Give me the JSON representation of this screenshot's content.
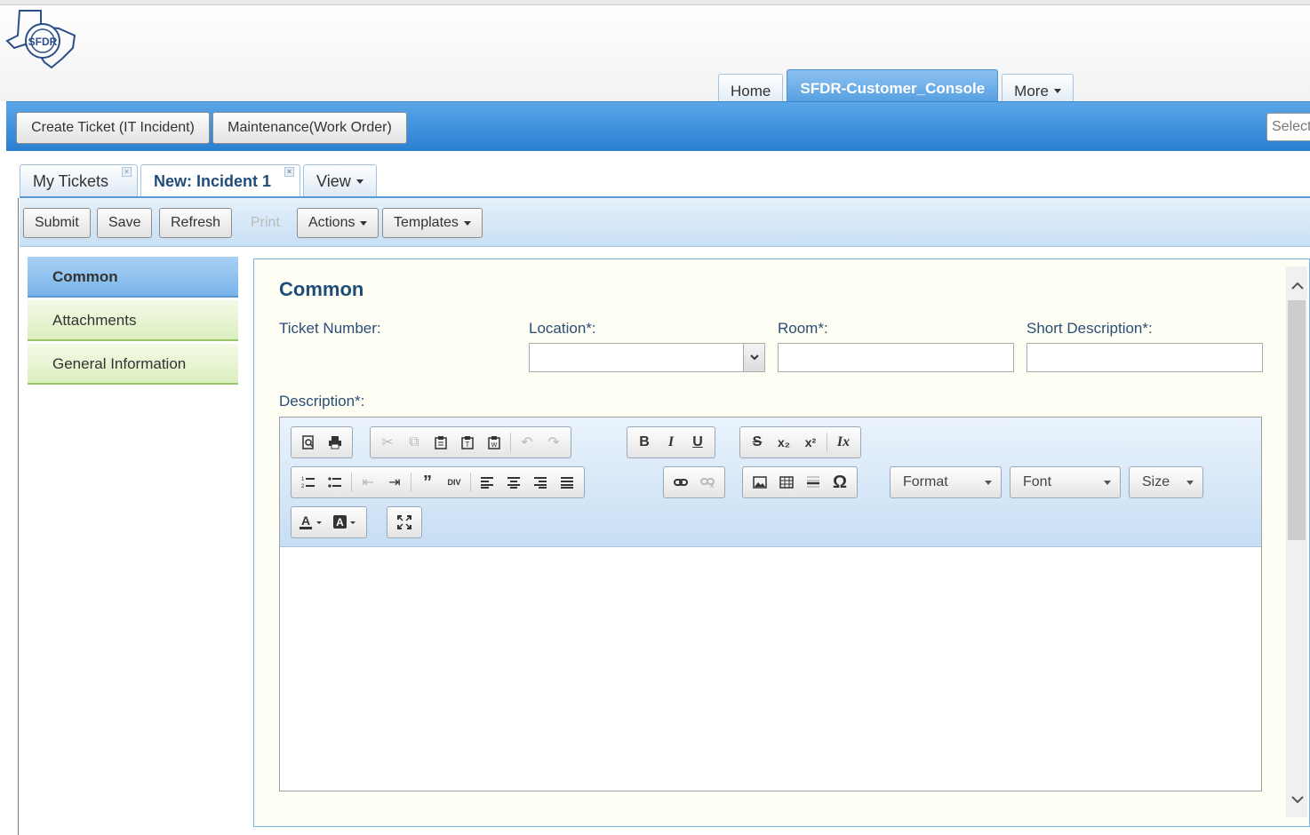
{
  "header": {
    "logo_text": "SFDR",
    "app_tabs": [
      {
        "label": "Home"
      },
      {
        "label": "SFDR-Customer_Console"
      },
      {
        "label": "More"
      }
    ]
  },
  "action_bar": {
    "create_ticket": "Create Ticket (IT Incident)",
    "maintenance": "Maintenance(Work Order)",
    "select_placeholder": "Select"
  },
  "sub_tabs": [
    {
      "label": "My Tickets"
    },
    {
      "label": "New: Incident 1"
    },
    {
      "label": "View"
    }
  ],
  "toolbar": {
    "submit": "Submit",
    "save": "Save",
    "refresh": "Refresh",
    "print": "Print",
    "actions": "Actions",
    "templates": "Templates"
  },
  "side_nav": [
    {
      "label": "Common"
    },
    {
      "label": "Attachments"
    },
    {
      "label": "General Information"
    }
  ],
  "form": {
    "title": "Common",
    "ticket_number_label": "Ticket Number:",
    "location_label": "Location*:",
    "room_label": "Room*:",
    "short_description_label": "Short Description*:",
    "description_label": "Description*:",
    "location_value": "",
    "room_value": "",
    "short_description_value": ""
  },
  "editor": {
    "format_label": "Format",
    "font_label": "Font",
    "size_label": "Size"
  },
  "colors": {
    "accent_blue": "#2a7fd2",
    "nav_active": "#78b4ea",
    "nav_green": "#dcefc0",
    "title_blue": "#1f4d7a"
  }
}
